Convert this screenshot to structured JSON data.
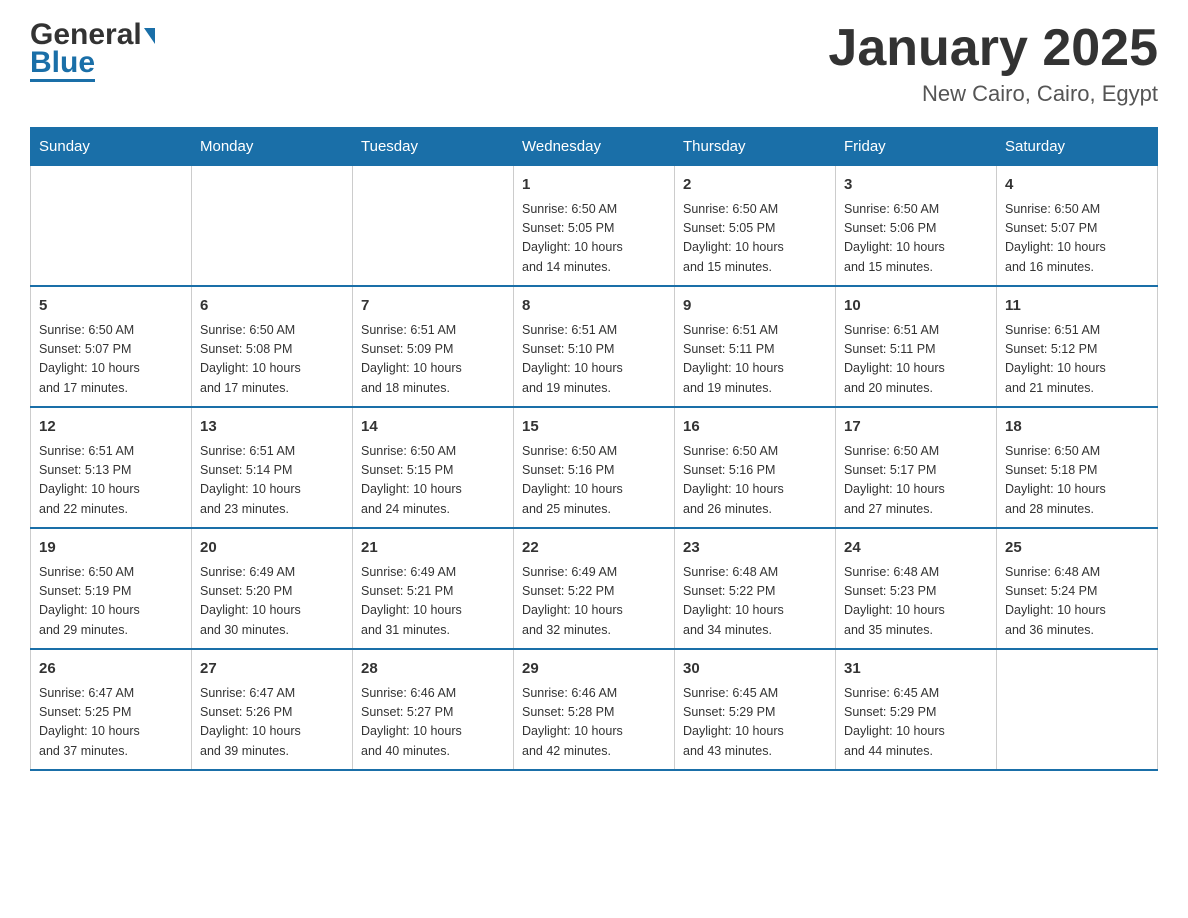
{
  "header": {
    "logo": {
      "general": "General",
      "blue": "Blue",
      "triangle": "▶"
    },
    "title": "January 2025",
    "subtitle": "New Cairo, Cairo, Egypt"
  },
  "calendar": {
    "days_of_week": [
      "Sunday",
      "Monday",
      "Tuesday",
      "Wednesday",
      "Thursday",
      "Friday",
      "Saturday"
    ],
    "weeks": [
      [
        {
          "day": "",
          "info": ""
        },
        {
          "day": "",
          "info": ""
        },
        {
          "day": "",
          "info": ""
        },
        {
          "day": "1",
          "info": "Sunrise: 6:50 AM\nSunset: 5:05 PM\nDaylight: 10 hours\nand 14 minutes."
        },
        {
          "day": "2",
          "info": "Sunrise: 6:50 AM\nSunset: 5:05 PM\nDaylight: 10 hours\nand 15 minutes."
        },
        {
          "day": "3",
          "info": "Sunrise: 6:50 AM\nSunset: 5:06 PM\nDaylight: 10 hours\nand 15 minutes."
        },
        {
          "day": "4",
          "info": "Sunrise: 6:50 AM\nSunset: 5:07 PM\nDaylight: 10 hours\nand 16 minutes."
        }
      ],
      [
        {
          "day": "5",
          "info": "Sunrise: 6:50 AM\nSunset: 5:07 PM\nDaylight: 10 hours\nand 17 minutes."
        },
        {
          "day": "6",
          "info": "Sunrise: 6:50 AM\nSunset: 5:08 PM\nDaylight: 10 hours\nand 17 minutes."
        },
        {
          "day": "7",
          "info": "Sunrise: 6:51 AM\nSunset: 5:09 PM\nDaylight: 10 hours\nand 18 minutes."
        },
        {
          "day": "8",
          "info": "Sunrise: 6:51 AM\nSunset: 5:10 PM\nDaylight: 10 hours\nand 19 minutes."
        },
        {
          "day": "9",
          "info": "Sunrise: 6:51 AM\nSunset: 5:11 PM\nDaylight: 10 hours\nand 19 minutes."
        },
        {
          "day": "10",
          "info": "Sunrise: 6:51 AM\nSunset: 5:11 PM\nDaylight: 10 hours\nand 20 minutes."
        },
        {
          "day": "11",
          "info": "Sunrise: 6:51 AM\nSunset: 5:12 PM\nDaylight: 10 hours\nand 21 minutes."
        }
      ],
      [
        {
          "day": "12",
          "info": "Sunrise: 6:51 AM\nSunset: 5:13 PM\nDaylight: 10 hours\nand 22 minutes."
        },
        {
          "day": "13",
          "info": "Sunrise: 6:51 AM\nSunset: 5:14 PM\nDaylight: 10 hours\nand 23 minutes."
        },
        {
          "day": "14",
          "info": "Sunrise: 6:50 AM\nSunset: 5:15 PM\nDaylight: 10 hours\nand 24 minutes."
        },
        {
          "day": "15",
          "info": "Sunrise: 6:50 AM\nSunset: 5:16 PM\nDaylight: 10 hours\nand 25 minutes."
        },
        {
          "day": "16",
          "info": "Sunrise: 6:50 AM\nSunset: 5:16 PM\nDaylight: 10 hours\nand 26 minutes."
        },
        {
          "day": "17",
          "info": "Sunrise: 6:50 AM\nSunset: 5:17 PM\nDaylight: 10 hours\nand 27 minutes."
        },
        {
          "day": "18",
          "info": "Sunrise: 6:50 AM\nSunset: 5:18 PM\nDaylight: 10 hours\nand 28 minutes."
        }
      ],
      [
        {
          "day": "19",
          "info": "Sunrise: 6:50 AM\nSunset: 5:19 PM\nDaylight: 10 hours\nand 29 minutes."
        },
        {
          "day": "20",
          "info": "Sunrise: 6:49 AM\nSunset: 5:20 PM\nDaylight: 10 hours\nand 30 minutes."
        },
        {
          "day": "21",
          "info": "Sunrise: 6:49 AM\nSunset: 5:21 PM\nDaylight: 10 hours\nand 31 minutes."
        },
        {
          "day": "22",
          "info": "Sunrise: 6:49 AM\nSunset: 5:22 PM\nDaylight: 10 hours\nand 32 minutes."
        },
        {
          "day": "23",
          "info": "Sunrise: 6:48 AM\nSunset: 5:22 PM\nDaylight: 10 hours\nand 34 minutes."
        },
        {
          "day": "24",
          "info": "Sunrise: 6:48 AM\nSunset: 5:23 PM\nDaylight: 10 hours\nand 35 minutes."
        },
        {
          "day": "25",
          "info": "Sunrise: 6:48 AM\nSunset: 5:24 PM\nDaylight: 10 hours\nand 36 minutes."
        }
      ],
      [
        {
          "day": "26",
          "info": "Sunrise: 6:47 AM\nSunset: 5:25 PM\nDaylight: 10 hours\nand 37 minutes."
        },
        {
          "day": "27",
          "info": "Sunrise: 6:47 AM\nSunset: 5:26 PM\nDaylight: 10 hours\nand 39 minutes."
        },
        {
          "day": "28",
          "info": "Sunrise: 6:46 AM\nSunset: 5:27 PM\nDaylight: 10 hours\nand 40 minutes."
        },
        {
          "day": "29",
          "info": "Sunrise: 6:46 AM\nSunset: 5:28 PM\nDaylight: 10 hours\nand 42 minutes."
        },
        {
          "day": "30",
          "info": "Sunrise: 6:45 AM\nSunset: 5:29 PM\nDaylight: 10 hours\nand 43 minutes."
        },
        {
          "day": "31",
          "info": "Sunrise: 6:45 AM\nSunset: 5:29 PM\nDaylight: 10 hours\nand 44 minutes."
        },
        {
          "day": "",
          "info": ""
        }
      ]
    ]
  }
}
